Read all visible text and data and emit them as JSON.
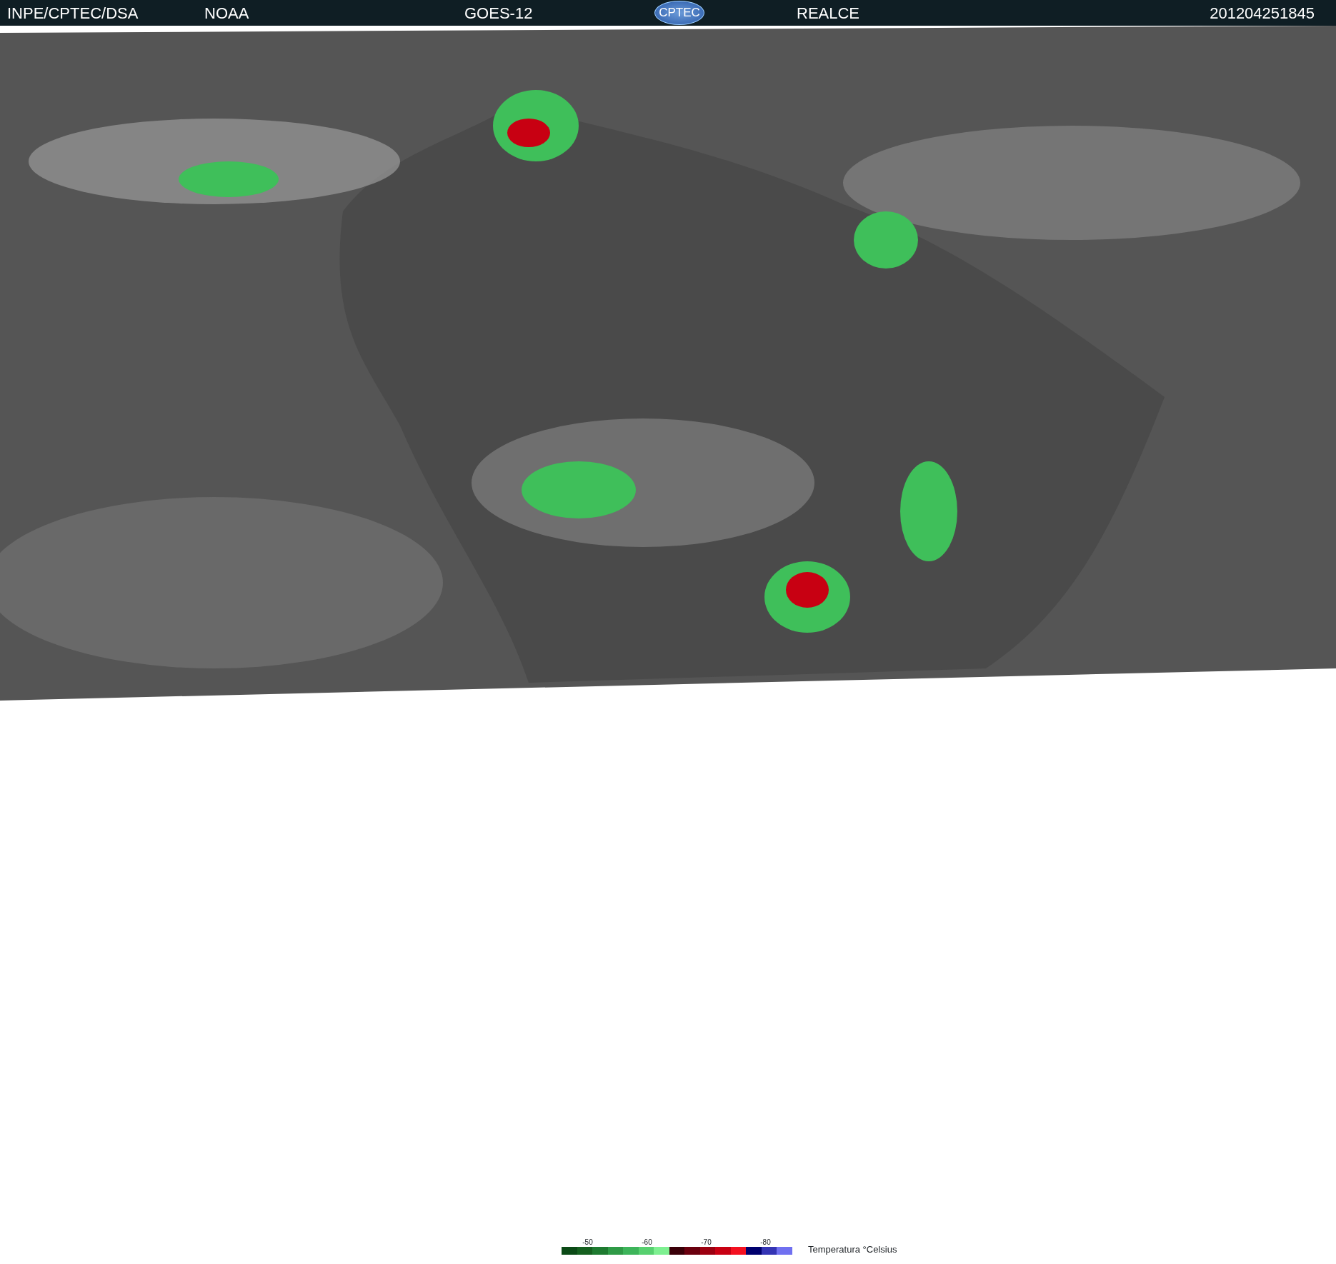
{
  "header": {
    "items": [
      {
        "kind": "text",
        "text": "INPE/CPTEC/DSA"
      },
      {
        "kind": "text",
        "text": "NOAA"
      },
      {
        "kind": "text",
        "text": "GOES-12"
      },
      {
        "kind": "logo",
        "text": "CPTEC"
      },
      {
        "kind": "text",
        "text": "REALCE"
      },
      {
        "kind": "text",
        "text": "201204251845"
      }
    ]
  },
  "legend": {
    "ticks": [
      "-50",
      "-60",
      "-70",
      "-80"
    ],
    "swatches": [
      {
        "color": "#0b4a16"
      },
      {
        "color": "#15601f"
      },
      {
        "color": "#1e7a30"
      },
      {
        "color": "#2f9a46"
      },
      {
        "color": "#3db45a"
      },
      {
        "color": "#57d06f"
      },
      {
        "color": "#7ef091"
      },
      {
        "color": "#3a0008"
      },
      {
        "color": "#6a000e"
      },
      {
        "color": "#9c0010"
      },
      {
        "color": "#c80012"
      },
      {
        "color": "#f41020"
      },
      {
        "color": "#00006e"
      },
      {
        "color": "#3434b4"
      },
      {
        "color": "#7070f0"
      }
    ],
    "title": "Temperatura °Celsius"
  }
}
